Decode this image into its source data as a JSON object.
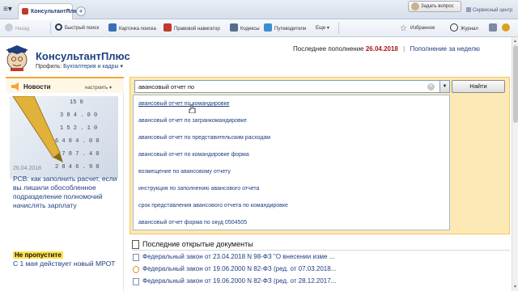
{
  "tab": {
    "title": "КонсультантПлюс"
  },
  "header_right": {
    "ask_question": "Задать вопрос",
    "service": "Сервисный центр"
  },
  "toolbar": {
    "back": "Назад",
    "quick_search": "Быстрый поиск",
    "search_card": "Карточка поиска",
    "legal_navigator": "Правовой навигатор",
    "codes": "Кодексы",
    "guides": "Путеводители",
    "more": "Еще",
    "favorites": "Избранное",
    "journal": "Журнал"
  },
  "brand": {
    "name": "КонсультантПлюс",
    "profile_label": "Профиль:",
    "profile_value": "Бухгалтерия и кадры"
  },
  "updates": {
    "last_label": "Последнее пополнение",
    "last_date": "26.04.2018",
    "week_link": "Пополнение за неделю"
  },
  "news": {
    "title": "Новости",
    "setup": "настроить",
    "image_numbers": [
      "15 0",
      "3 8 4 . 0 0",
      "1 5 2 . 1 0",
      "6 4 8 4 . 0 0",
      "5 7 8 7 . 4 0",
      "2 8 4 6 . 9 0"
    ],
    "date": "26.04.2018",
    "headline": "РСВ: как заполнить расчет, если вы лишили обособленное подразделение полномочий начислять зарплату",
    "dont_miss": "Не пропустите",
    "dont_miss_text": "С 1 мая действует новый МРОТ"
  },
  "search": {
    "query": "авансовый отчет по",
    "find_button": "Найти",
    "suggestions": [
      "авансовый отчет по командировке",
      "авансовый отчет по загранкомандировке",
      "авансовый отчет по представительским расходам",
      "авансовый отчет по командировке форма",
      "возмещение по авансовому отчету",
      "инструкция по заполнению авансового отчета",
      "срок представления авансового отчета по командировке",
      "авансовый отчет форма по окуд 0504505"
    ]
  },
  "recent": {
    "title": "Последние открытые документы",
    "documents": [
      "Федеральный закон от 23.04.2018 N 98-ФЗ \"О внесении изме ...",
      "Федеральный закон от 19.06.2000 N 82-ФЗ (ред. от 07.03.2018...",
      "Федеральный закон от 19.06.2000 N 82-ФЗ (ред. от 28.12.2017..."
    ]
  },
  "colors": {
    "brand_blue": "#1d3f82",
    "date_red": "#b0141b",
    "search_panel": "#fde9b5",
    "highlight_yellow": "#ffe14d"
  }
}
